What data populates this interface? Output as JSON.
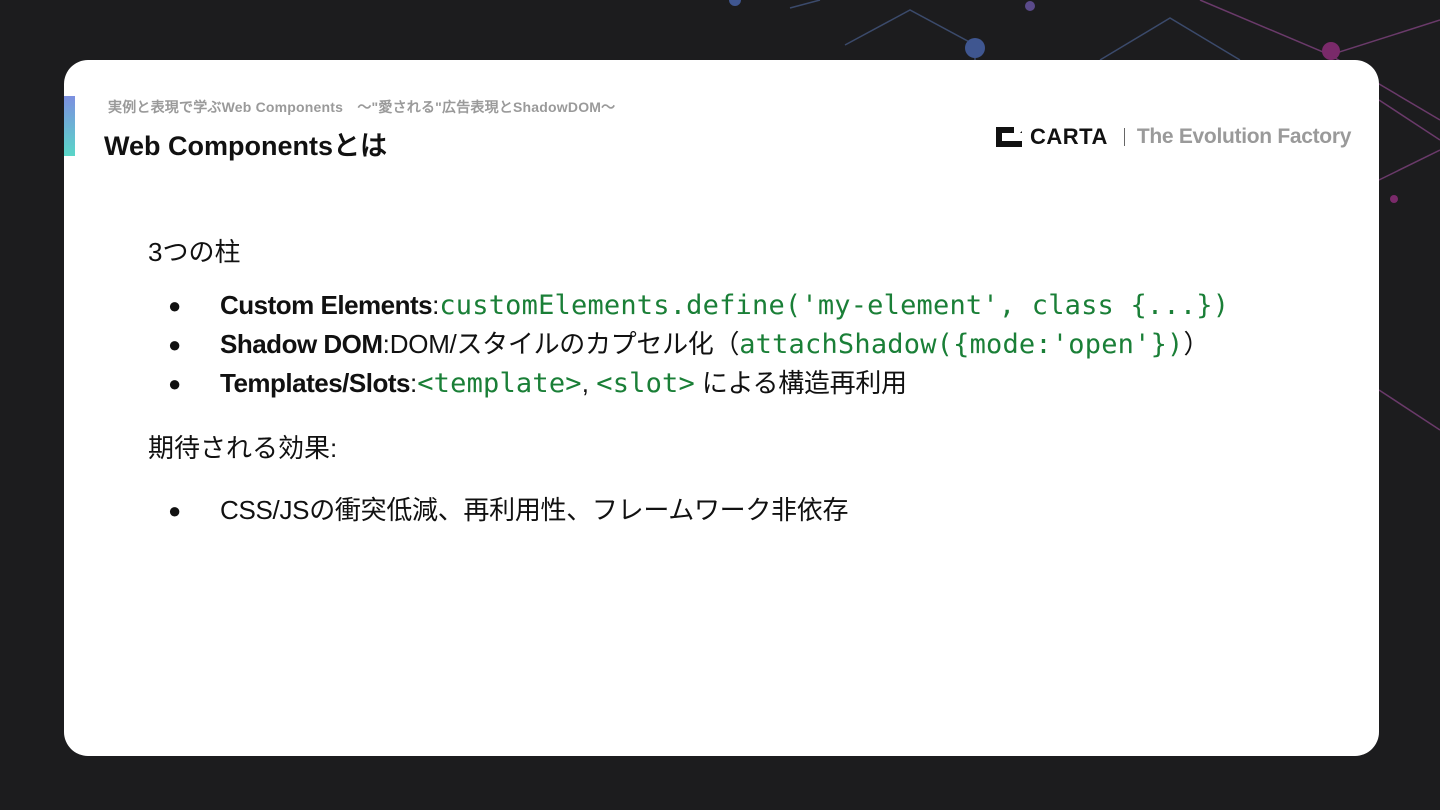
{
  "colors": {
    "background": "#1c1c1e",
    "card": "#ffffff",
    "code_green": "#1a7f37",
    "accent_top": "#7c8fe0",
    "accent_bottom": "#5ad6c8"
  },
  "header": {
    "subtitle": "実例と表現で学ぶWeb Components　〜\"愛される\"広告表現とShadowDOM〜",
    "title": "Web Componentsとは"
  },
  "logo": {
    "name": "CARTA",
    "tagline": "The Evolution Factory",
    "icon": "carta-logo-icon"
  },
  "sections": {
    "pillars_heading": "3つの柱",
    "pillars": [
      {
        "bullet": "●",
        "term": "Custom Elements",
        "sep": ":",
        "code": "customElements.define('my-element', class {...})"
      },
      {
        "bullet": "●",
        "term": "Shadow DOM",
        "sep": ":",
        "text": "DOM/スタイルのカプセル化（",
        "code": "attachShadow({mode:'open'})",
        "close": "）"
      },
      {
        "bullet": "●",
        "term": "Templates/Slots",
        "sep": ":",
        "code1": "<template>",
        "comma": ",",
        "code2": "<slot>",
        "text": " による構造再利用"
      }
    ],
    "effects_heading": "期待される効果:",
    "effects": [
      {
        "bullet": "●",
        "text": "CSS/JSの衝突低減、再利用性、フレームワーク非依存"
      }
    ]
  }
}
